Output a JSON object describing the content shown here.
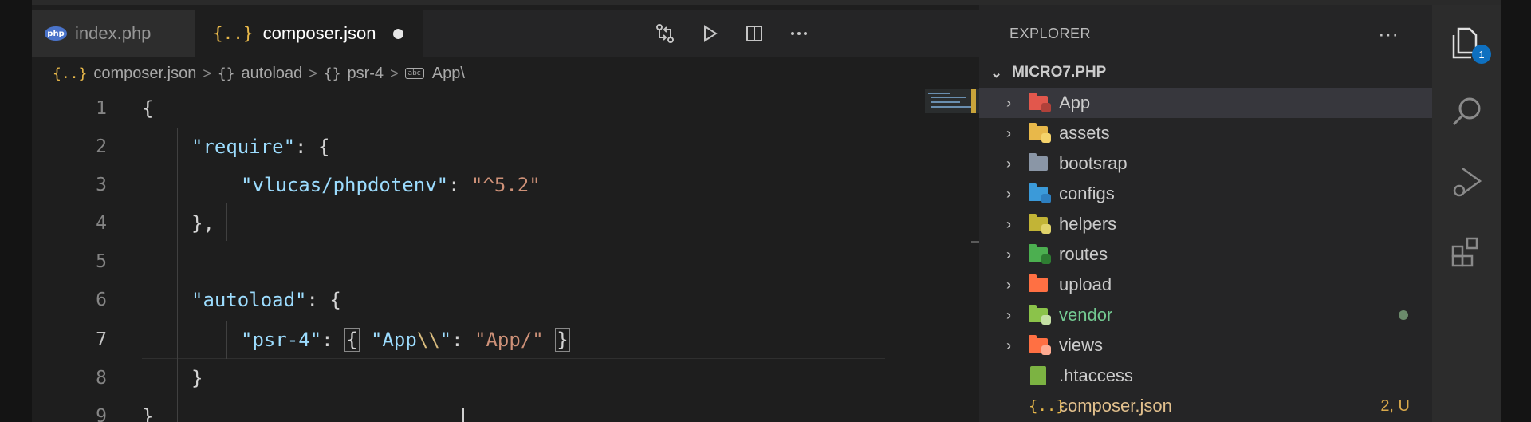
{
  "tabs": [
    {
      "label": "index.php",
      "icon": "php-icon"
    },
    {
      "label": "composer.json",
      "icon": "json-icon",
      "modified": true
    }
  ],
  "breadcrumb": [
    {
      "icon": "{..}",
      "label": "composer.json"
    },
    {
      "icon": "{}",
      "label": "autoload"
    },
    {
      "icon": "{}",
      "label": "psr-4"
    },
    {
      "icon": "abc",
      "label": "App\\"
    }
  ],
  "editor": {
    "line_numbers": [
      "1",
      "2",
      "3",
      "4",
      "5",
      "6",
      "7",
      "8",
      "9"
    ],
    "active_line": "7",
    "lines": [
      {
        "open_brace": "{"
      },
      {
        "key": "\"require\"",
        "colon": ": ",
        "brace": "{"
      },
      {
        "key": "\"vlucas/phpdotenv\"",
        "colon": ": ",
        "value": "\"^5.2\""
      },
      {
        "text": "},"
      },
      {},
      {
        "key": "\"autoload\"",
        "colon": ": ",
        "brace": "{"
      },
      {
        "key": "\"psr-4\"",
        "colon": ": ",
        "open": "{",
        "inner_key_a": "\"App",
        "inner_key_esc": "\\\\",
        "inner_key_b": "\"",
        "inner_colon": ": ",
        "inner_value": "\"App/\"",
        "close": "}"
      },
      {
        "text": "}"
      },
      {
        "text": "}"
      }
    ]
  },
  "explorer": {
    "title": "EXPLORER",
    "more": "···",
    "workspace": "MICRO7.PHP",
    "items": [
      {
        "name": "App",
        "color": "#e2574c",
        "selected": true
      },
      {
        "name": "assets",
        "color": "#e8b84a"
      },
      {
        "name": "bootsrap",
        "color": "#8a96a6"
      },
      {
        "name": "configs",
        "color": "#3b9ad9"
      },
      {
        "name": "helpers",
        "color": "#c2b436"
      },
      {
        "name": "routes",
        "color": "#4caf50"
      },
      {
        "name": "upload",
        "color": "#ff7043"
      },
      {
        "name": "vendor",
        "color": "#8bc34a",
        "git": "dot"
      },
      {
        "name": "views",
        "color": "#ff7043"
      }
    ],
    "files": [
      {
        "name": ".htaccess",
        "color": "#7cb342"
      },
      {
        "name": "composer.json",
        "color": "#e8b84a",
        "status": "2, U"
      }
    ]
  },
  "activity": {
    "explorer_badge": "1"
  },
  "colors": {
    "editor_bg": "#1e1e1e",
    "sidebar_bg": "#252526",
    "key": "#9cdcfe",
    "string": "#ce9178"
  }
}
